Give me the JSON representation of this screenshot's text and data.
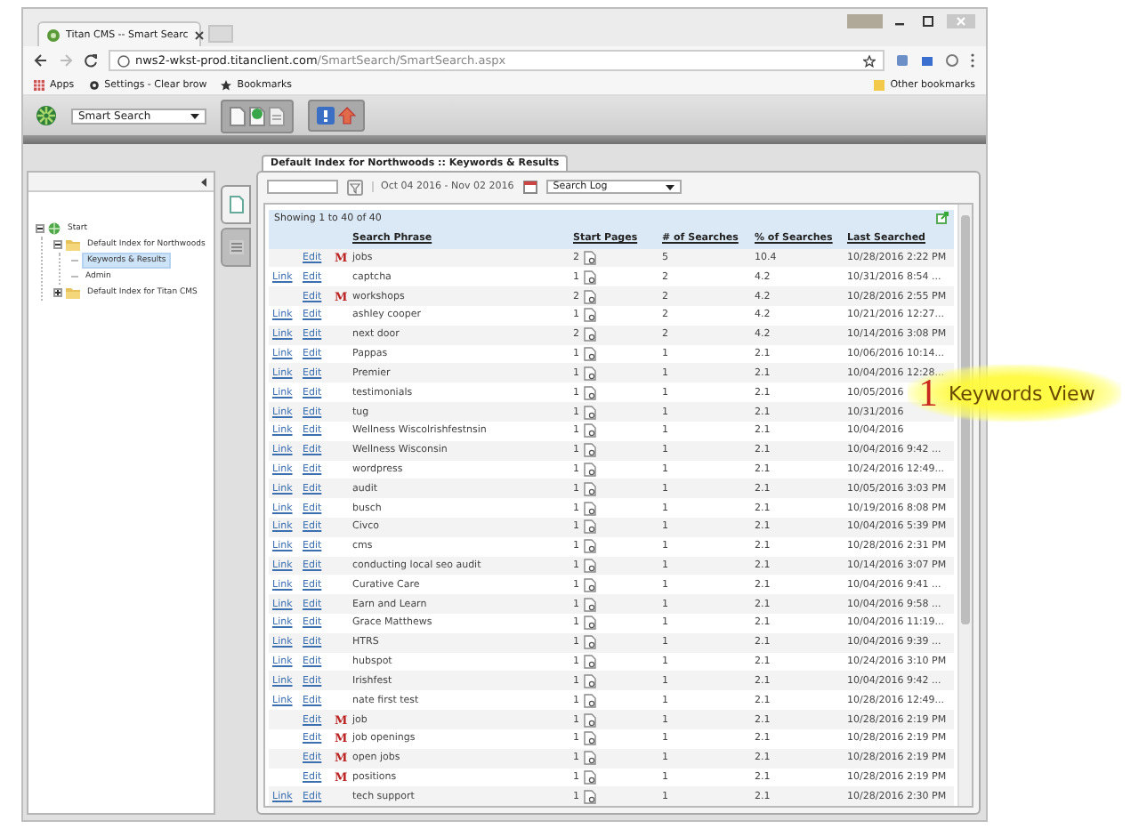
{
  "browser": {
    "tab_title": "Titan CMS -- Smart Searc",
    "url_host": "nws2-wkst-prod.titanclient.com",
    "url_path": "/SmartSearch/SmartSearch.aspx",
    "bookmarks": [
      "Apps",
      "Settings - Clear brow",
      "Bookmarks"
    ],
    "other_bookmarks": "Other bookmarks"
  },
  "app": {
    "module": "Smart Search"
  },
  "tree": [
    {
      "label": "Start",
      "kind": "root",
      "expanded": true,
      "selected": false,
      "children": [
        {
          "label": "Default Index for Northwoods",
          "kind": "folder",
          "expanded": true,
          "selected": false,
          "children": [
            {
              "label": "Keywords & Results",
              "kind": "leaf",
              "selected": true
            },
            {
              "label": "Admin",
              "kind": "leaf",
              "selected": false
            }
          ]
        },
        {
          "label": "Default Index for Titan CMS",
          "kind": "folder",
          "expanded": false,
          "selected": false
        }
      ]
    }
  ],
  "panel": {
    "tab": "Default Index for Northwoods :: Keywords & Results",
    "date_range": "Oct 04 2016 - Nov 02 2016",
    "view": "Search Log",
    "summary": "Showing 1 to 40 of 40"
  },
  "table": {
    "columns": [
      "Search Phrase",
      "Start Pages",
      "# of Searches",
      "% of Searches",
      "Last Searched"
    ],
    "rows": [
      {
        "edit": "Edit",
        "flag": "M",
        "phrase": "jobs",
        "start_pages": "2",
        "searches": "5",
        "percent": "10.4",
        "last": "10/28/2016 2:22 PM"
      },
      {
        "link": "Link",
        "edit": "Edit",
        "phrase": "captcha",
        "start_pages": "1",
        "searches": "2",
        "percent": "4.2",
        "last": "10/31/2016 8:54 ..."
      },
      {
        "edit": "Edit",
        "flag": "M",
        "phrase": "workshops",
        "start_pages": "2",
        "searches": "2",
        "percent": "4.2",
        "last": "10/28/2016 2:55 PM"
      },
      {
        "link": "Link",
        "edit": "Edit",
        "phrase": "ashley cooper",
        "start_pages": "1",
        "searches": "2",
        "percent": "4.2",
        "last": "10/21/2016 12:27..."
      },
      {
        "link": "Link",
        "edit": "Edit",
        "phrase": "next door",
        "start_pages": "2",
        "searches": "2",
        "percent": "4.2",
        "last": "10/14/2016 3:08 PM"
      },
      {
        "link": "Link",
        "edit": "Edit",
        "phrase": "Pappas",
        "start_pages": "1",
        "searches": "1",
        "percent": "2.1",
        "last": "10/06/2016 10:14..."
      },
      {
        "link": "Link",
        "edit": "Edit",
        "phrase": "Premier",
        "start_pages": "1",
        "searches": "1",
        "percent": "2.1",
        "last": "10/04/2016 12:28..."
      },
      {
        "link": "Link",
        "edit": "Edit",
        "phrase": "testimonials",
        "start_pages": "1",
        "searches": "1",
        "percent": "2.1",
        "last": "10/05/2016"
      },
      {
        "link": "Link",
        "edit": "Edit",
        "phrase": "tug",
        "start_pages": "1",
        "searches": "1",
        "percent": "2.1",
        "last": "10/31/2016"
      },
      {
        "link": "Link",
        "edit": "Edit",
        "phrase": "Wellness Wiscolrishfestnsin",
        "start_pages": "1",
        "searches": "1",
        "percent": "2.1",
        "last": "10/04/2016"
      },
      {
        "link": "Link",
        "edit": "Edit",
        "phrase": "Wellness Wisconsin",
        "start_pages": "1",
        "searches": "1",
        "percent": "2.1",
        "last": "10/04/2016 9:42 ..."
      },
      {
        "link": "Link",
        "edit": "Edit",
        "phrase": "wordpress",
        "start_pages": "1",
        "searches": "1",
        "percent": "2.1",
        "last": "10/24/2016 12:49..."
      },
      {
        "link": "Link",
        "edit": "Edit",
        "phrase": "audit",
        "start_pages": "1",
        "searches": "1",
        "percent": "2.1",
        "last": "10/05/2016 3:03 PM"
      },
      {
        "link": "Link",
        "edit": "Edit",
        "phrase": "busch",
        "start_pages": "1",
        "searches": "1",
        "percent": "2.1",
        "last": "10/19/2016 8:08 PM"
      },
      {
        "link": "Link",
        "edit": "Edit",
        "phrase": "Civco",
        "start_pages": "1",
        "searches": "1",
        "percent": "2.1",
        "last": "10/04/2016 5:39 PM"
      },
      {
        "link": "Link",
        "edit": "Edit",
        "phrase": "cms",
        "start_pages": "1",
        "searches": "1",
        "percent": "2.1",
        "last": "10/28/2016 2:31 PM"
      },
      {
        "link": "Link",
        "edit": "Edit",
        "phrase": "conducting local seo audit",
        "start_pages": "1",
        "searches": "1",
        "percent": "2.1",
        "last": "10/14/2016 3:07 PM"
      },
      {
        "link": "Link",
        "edit": "Edit",
        "phrase": "Curative Care",
        "start_pages": "1",
        "searches": "1",
        "percent": "2.1",
        "last": "10/04/2016 9:41 ..."
      },
      {
        "link": "Link",
        "edit": "Edit",
        "phrase": "Earn and Learn",
        "start_pages": "1",
        "searches": "1",
        "percent": "2.1",
        "last": "10/04/2016 9:58 ..."
      },
      {
        "link": "Link",
        "edit": "Edit",
        "phrase": "Grace Matthews",
        "start_pages": "1",
        "searches": "1",
        "percent": "2.1",
        "last": "10/04/2016 11:19..."
      },
      {
        "link": "Link",
        "edit": "Edit",
        "phrase": "HTRS",
        "start_pages": "1",
        "searches": "1",
        "percent": "2.1",
        "last": "10/04/2016 9:39 ..."
      },
      {
        "link": "Link",
        "edit": "Edit",
        "phrase": "hubspot",
        "start_pages": "1",
        "searches": "1",
        "percent": "2.1",
        "last": "10/24/2016 3:10 PM"
      },
      {
        "link": "Link",
        "edit": "Edit",
        "phrase": "Irishfest",
        "start_pages": "1",
        "searches": "1",
        "percent": "2.1",
        "last": "10/04/2016 9:42 ..."
      },
      {
        "link": "Link",
        "edit": "Edit",
        "phrase": "nate first test",
        "start_pages": "1",
        "searches": "1",
        "percent": "2.1",
        "last": "10/28/2016 12:49..."
      },
      {
        "edit": "Edit",
        "flag": "M",
        "phrase": "job",
        "start_pages": "1",
        "searches": "1",
        "percent": "2.1",
        "last": "10/28/2016 2:19 PM"
      },
      {
        "edit": "Edit",
        "flag": "M",
        "phrase": "job openings",
        "start_pages": "1",
        "searches": "1",
        "percent": "2.1",
        "last": "10/28/2016 2:19 PM"
      },
      {
        "edit": "Edit",
        "flag": "M",
        "phrase": "open jobs",
        "start_pages": "1",
        "searches": "1",
        "percent": "2.1",
        "last": "10/28/2016 2:19 PM"
      },
      {
        "edit": "Edit",
        "flag": "M",
        "phrase": "positions",
        "start_pages": "1",
        "searches": "1",
        "percent": "2.1",
        "last": "10/28/2016 2:19 PM"
      },
      {
        "link": "Link",
        "edit": "Edit",
        "phrase": "tech support",
        "start_pages": "1",
        "searches": "1",
        "percent": "2.1",
        "last": "10/28/2016 2:30 PM"
      }
    ]
  },
  "callout": {
    "number": "1",
    "label": "Keywords View"
  }
}
